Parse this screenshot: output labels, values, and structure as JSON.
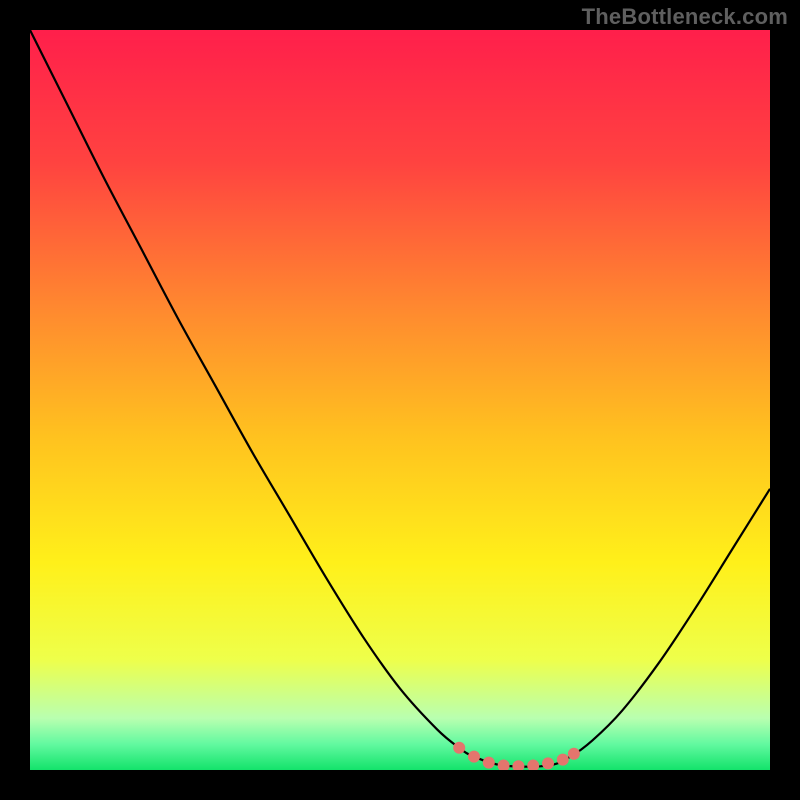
{
  "watermark": "TheBottleneck.com",
  "chart_data": {
    "type": "line",
    "title": "",
    "xlabel": "",
    "ylabel": "",
    "xlim": [
      0,
      100
    ],
    "ylim": [
      0,
      100
    ],
    "grid": false,
    "legend": false,
    "background_gradient_stops": [
      {
        "offset": 0.0,
        "color": "#ff1f4b"
      },
      {
        "offset": 0.18,
        "color": "#ff4340"
      },
      {
        "offset": 0.38,
        "color": "#ff8a2f"
      },
      {
        "offset": 0.55,
        "color": "#ffc21f"
      },
      {
        "offset": 0.72,
        "color": "#fff01a"
      },
      {
        "offset": 0.85,
        "color": "#eeff4a"
      },
      {
        "offset": 0.93,
        "color": "#b9ffb0"
      },
      {
        "offset": 0.965,
        "color": "#62f9a0"
      },
      {
        "offset": 1.0,
        "color": "#13e36b"
      }
    ],
    "series": [
      {
        "name": "bottleneck-curve",
        "color": "#000000",
        "x": [
          0,
          5,
          10,
          15,
          20,
          25,
          30,
          35,
          40,
          45,
          50,
          55,
          58,
          60,
          64,
          70,
          73,
          76,
          80,
          85,
          90,
          95,
          100
        ],
        "y": [
          100,
          90,
          80,
          70.5,
          61,
          52,
          43,
          34.5,
          26,
          18,
          11,
          5.5,
          3,
          1.8,
          0.6,
          0.6,
          1.8,
          4,
          8,
          14.5,
          22,
          30,
          38
        ]
      }
    ],
    "markers": {
      "name": "trough-dots",
      "color": "#e4756d",
      "radius_px": 6,
      "x": [
        58,
        60,
        62,
        64,
        66,
        68,
        70,
        72,
        73.5
      ],
      "y": [
        3.0,
        1.8,
        1.0,
        0.6,
        0.5,
        0.6,
        0.9,
        1.4,
        2.2
      ]
    }
  }
}
